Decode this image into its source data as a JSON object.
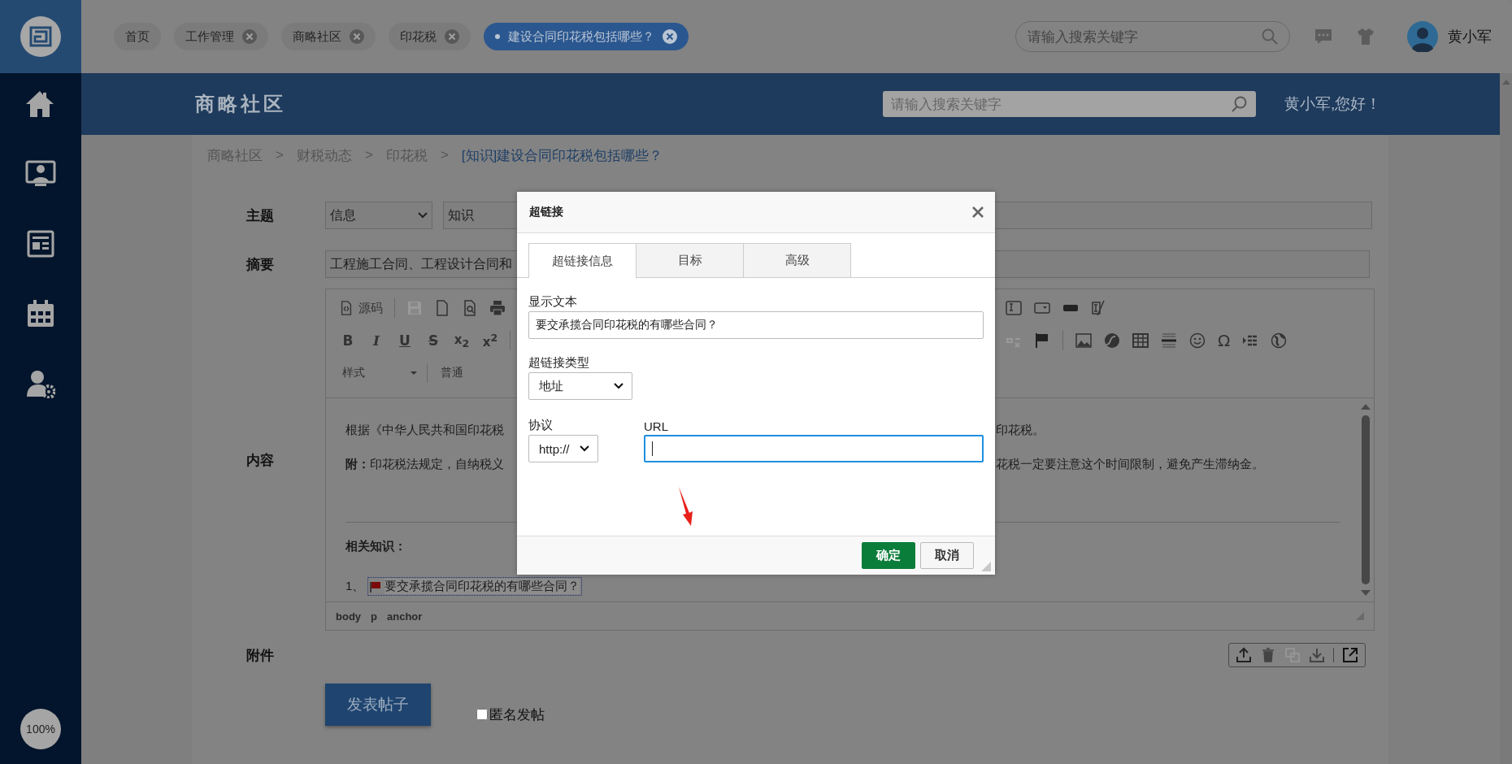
{
  "sidebar": {
    "zoom_label": "100%"
  },
  "tabs": [
    {
      "label": "首页",
      "closable": false,
      "selected": false
    },
    {
      "label": "工作管理",
      "closable": true,
      "selected": false
    },
    {
      "label": "商略社区",
      "closable": true,
      "selected": false
    },
    {
      "label": "印花税",
      "closable": true,
      "selected": false
    },
    {
      "label": "建设合同印花税包括哪些？",
      "closable": true,
      "selected": true
    }
  ],
  "top_search": {
    "placeholder": "请输入搜索关键字"
  },
  "user": {
    "name": "黄小军"
  },
  "header": {
    "title": "商略社区",
    "search": {
      "placeholder": "请输入搜索关键字"
    },
    "greeting": "黄小军,您好！"
  },
  "breadcrumb": [
    {
      "kind": "link",
      "label": "商略社区",
      "current": false
    },
    {
      "kind": "separator",
      "label": ">"
    },
    {
      "kind": "link",
      "label": "财税动态",
      "current": false
    },
    {
      "kind": "separator",
      "label": ">"
    },
    {
      "kind": "link",
      "label": "印花税",
      "current": false
    },
    {
      "kind": "separator",
      "label": ">"
    },
    {
      "kind": "link",
      "label": "[知识]建设合同印花税包括哪些？",
      "current": true
    }
  ],
  "form": {
    "subject": {
      "label": "主题",
      "category": "信息",
      "type": "知识"
    },
    "summary": {
      "label": "摘要",
      "value": "工程施工合同、工程设计合同和"
    },
    "content": {
      "label": "内容"
    },
    "attachment": {
      "label": "附件",
      "copy_disabled": true
    },
    "submit": "发表帖子",
    "anonymous": {
      "label": "匿名发帖",
      "checked": false
    }
  },
  "editor": {
    "toolbar": {
      "source": "源码",
      "save_disabled": true,
      "format": [
        {
          "kind": "bold",
          "glyph": "B"
        },
        {
          "kind": "italic",
          "glyph": "I"
        },
        {
          "kind": "underline",
          "glyph": "U"
        },
        {
          "kind": "strike",
          "glyph": "S"
        },
        {
          "kind": "sub",
          "glyph": "x$_{2}$"
        },
        {
          "kind": "sup",
          "glyph": "x$^{2}$"
        }
      ],
      "unlink_disabled": true,
      "special_char": "Ω",
      "style": "样式",
      "paragraph": "普通"
    },
    "lines": [
      {
        "left": "根据《中华人民共和国印花税",
        "right": "印花税。"
      },
      {
        "left": "**附：**印花税法规定，自纳税义",
        "right": "花税一定要注意这个时间限制，避免产生滞纳金。"
      }
    ],
    "related": {
      "title": "相关知识：",
      "items": [
        {
          "number": "1、",
          "text": "要交承揽合同印花税的有哪些合同？"
        }
      ]
    },
    "path": [
      "body",
      "p",
      "anchor"
    ]
  },
  "dialog": {
    "title": "超链接",
    "tabs": [
      {
        "label": "超链接信息",
        "selected": true
      },
      {
        "label": "目标",
        "selected": false
      },
      {
        "label": "高级",
        "selected": false
      }
    ],
    "display_text": {
      "label": "显示文本",
      "value": "要交承揽合同印花税的有哪些合同？"
    },
    "link_type": {
      "label": "超链接类型",
      "value": "地址"
    },
    "protocol": {
      "label": "协议",
      "value": "http://"
    },
    "url": {
      "label": "URL",
      "focused": true
    },
    "buttons": [
      {
        "kind": "primary",
        "label": "确定"
      },
      {
        "kind": "secondary",
        "label": "取消"
      }
    ]
  }
}
